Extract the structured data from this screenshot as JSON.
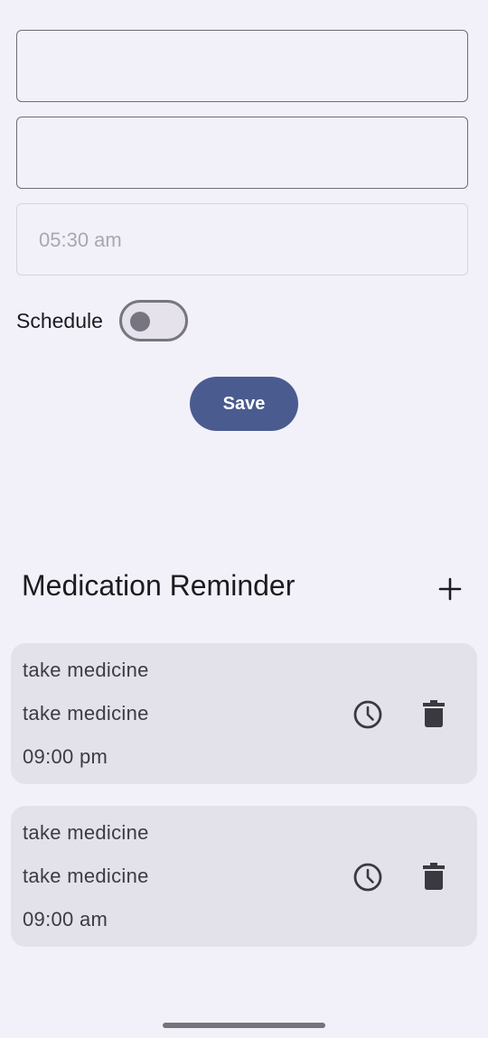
{
  "form": {
    "field1_value": "",
    "field2_value": "",
    "time_value": "05:30 am",
    "schedule_label": "Schedule",
    "schedule_on": false,
    "save_label": "Save"
  },
  "section": {
    "title": "Medication Reminder"
  },
  "reminders": [
    {
      "title": "take medicine",
      "description": "take medicine",
      "time": "09:00 pm"
    },
    {
      "title": "take medicine",
      "description": "take medicine",
      "time": "09:00 am"
    }
  ],
  "icons": {
    "add": "add-icon",
    "clock": "clock-icon",
    "trash": "trash-icon"
  },
  "colors": {
    "background": "#f2f0f9",
    "primary": "#4a5b90",
    "card": "#e3e1ea"
  }
}
